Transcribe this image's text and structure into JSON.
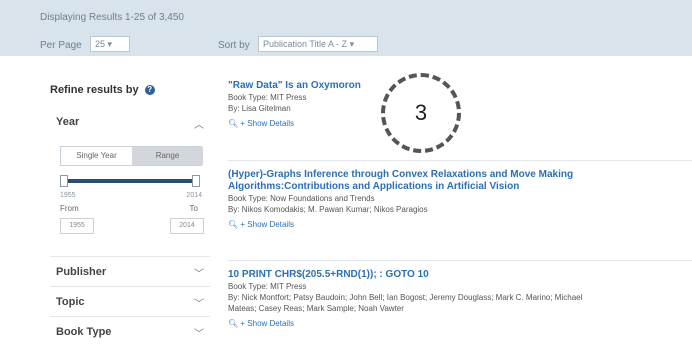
{
  "header": {
    "results_count": "Displaying Results 1-25 of 3,450",
    "per_page_label": "Per Page",
    "per_page_value": "25",
    "sort_by_label": "Sort by",
    "sort_by_value": "Publication Title A - Z"
  },
  "sidebar": {
    "refine_label": "Refine results by",
    "year": {
      "label": "Year",
      "toggle_single": "Single Year",
      "toggle_range": "Range",
      "slider_min": "1955",
      "slider_max": "2014",
      "from_label": "From",
      "to_label": "To",
      "from_value": "1955",
      "to_value": "2014"
    },
    "facets": [
      {
        "label": "Publisher"
      },
      {
        "label": "Topic"
      },
      {
        "label": "Book Type"
      }
    ]
  },
  "results": [
    {
      "title": "\"Raw Data\" Is an Oxymoron",
      "line1": "Book Type: MIT Press",
      "line2": "By: Lisa Gitelman",
      "line3": "",
      "details": "Show Details"
    },
    {
      "title": "(Hyper)-Graphs Inference through Convex Relaxations and Move Making Algorithms:Contributions and Applications in Artificial Vision",
      "line1": "Book Type: Now Foundations and Trends",
      "line2": "By: Nikos Komodakis; M. Pawan Kumar; Nikos Paragios",
      "line3": "",
      "details": "Show Details"
    },
    {
      "title": "10 PRINT CHR$(205.5+RND(1)); : GOTO 10",
      "line1": "Book Type: MIT Press",
      "line2": "By: Nick Montfort; Patsy Baudoin; John Bell; Ian Bogost; Jeremy Douglass; Mark C. Marino; Michael",
      "line3": "Mateas; Casey Reas; Mark Sample; Noah Vawter",
      "details": "Show Details"
    }
  ],
  "callout": {
    "number": "3"
  }
}
